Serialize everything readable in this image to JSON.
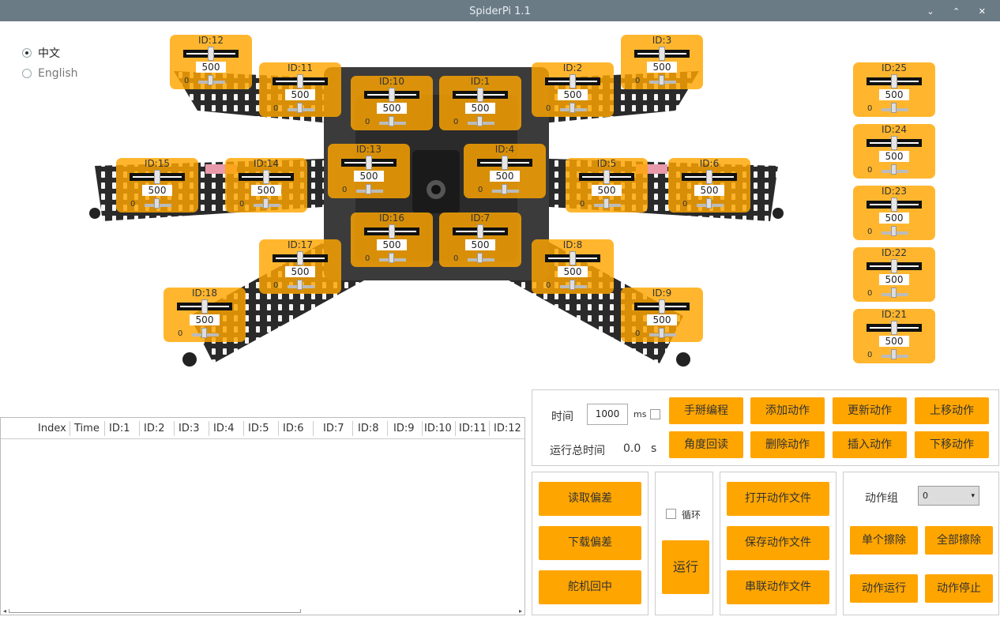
{
  "window": {
    "title": "SpiderPi 1.1",
    "controls": "⌄ ⌃ ✕"
  },
  "language": {
    "options": [
      "中文",
      "English"
    ],
    "selected": "中文"
  },
  "servos": [
    {
      "id": "ID:12",
      "value": "500",
      "min": "0"
    },
    {
      "id": "ID:11",
      "value": "500",
      "min": "0"
    },
    {
      "id": "ID:10",
      "value": "500",
      "min": "0"
    },
    {
      "id": "ID:1",
      "value": "500",
      "min": "0"
    },
    {
      "id": "ID:2",
      "value": "500",
      "min": "0"
    },
    {
      "id": "ID:3",
      "value": "500",
      "min": "0"
    },
    {
      "id": "ID:15",
      "value": "500",
      "min": "0"
    },
    {
      "id": "ID:14",
      "value": "500",
      "min": "0"
    },
    {
      "id": "ID:13",
      "value": "500",
      "min": "0"
    },
    {
      "id": "ID:4",
      "value": "500",
      "min": "0"
    },
    {
      "id": "ID:5",
      "value": "500",
      "min": "0"
    },
    {
      "id": "ID:6",
      "value": "500",
      "min": "0"
    },
    {
      "id": "ID:16",
      "value": "500",
      "min": "0"
    },
    {
      "id": "ID:7",
      "value": "500",
      "min": "0"
    },
    {
      "id": "ID:17",
      "value": "500",
      "min": "0"
    },
    {
      "id": "ID:8",
      "value": "500",
      "min": "0"
    },
    {
      "id": "ID:18",
      "value": "500",
      "min": "0"
    },
    {
      "id": "ID:9",
      "value": "500",
      "min": "0"
    },
    {
      "id": "ID:25",
      "value": "500",
      "min": "0"
    },
    {
      "id": "ID:24",
      "value": "500",
      "min": "0"
    },
    {
      "id": "ID:23",
      "value": "500",
      "min": "0"
    },
    {
      "id": "ID:22",
      "value": "500",
      "min": "0"
    },
    {
      "id": "ID:21",
      "value": "500",
      "min": "0"
    }
  ],
  "table": {
    "columns": [
      "Index",
      "Time",
      "ID:1",
      "ID:2",
      "ID:3",
      "ID:4",
      "ID:5",
      "ID:6",
      "ID:7",
      "ID:8",
      "ID:9",
      "ID:10",
      "ID:11",
      "ID:12"
    ]
  },
  "controls": {
    "time_label": "时间",
    "time_value": "1000",
    "time_unit": "ms",
    "total_time_label": "运行总时间",
    "total_time_value": "0.0",
    "total_time_unit": "s",
    "buttons_top": [
      "手掰编程",
      "添加动作",
      "更新动作",
      "上移动作",
      "角度回读",
      "删除动作",
      "插入动作",
      "下移动作"
    ],
    "read_offset": "读取偏差",
    "download_offset": "下载偏差",
    "servo_center": "舵机回中",
    "loop_label": "循环",
    "run": "运行",
    "open_file": "打开动作文件",
    "save_file": "保存动作文件",
    "chain_file": "串联动作文件",
    "group_label": "动作组",
    "group_value": "0",
    "erase_one": "单个擦除",
    "erase_all": "全部擦除",
    "group_run": "动作运行",
    "group_stop": "动作停止"
  }
}
